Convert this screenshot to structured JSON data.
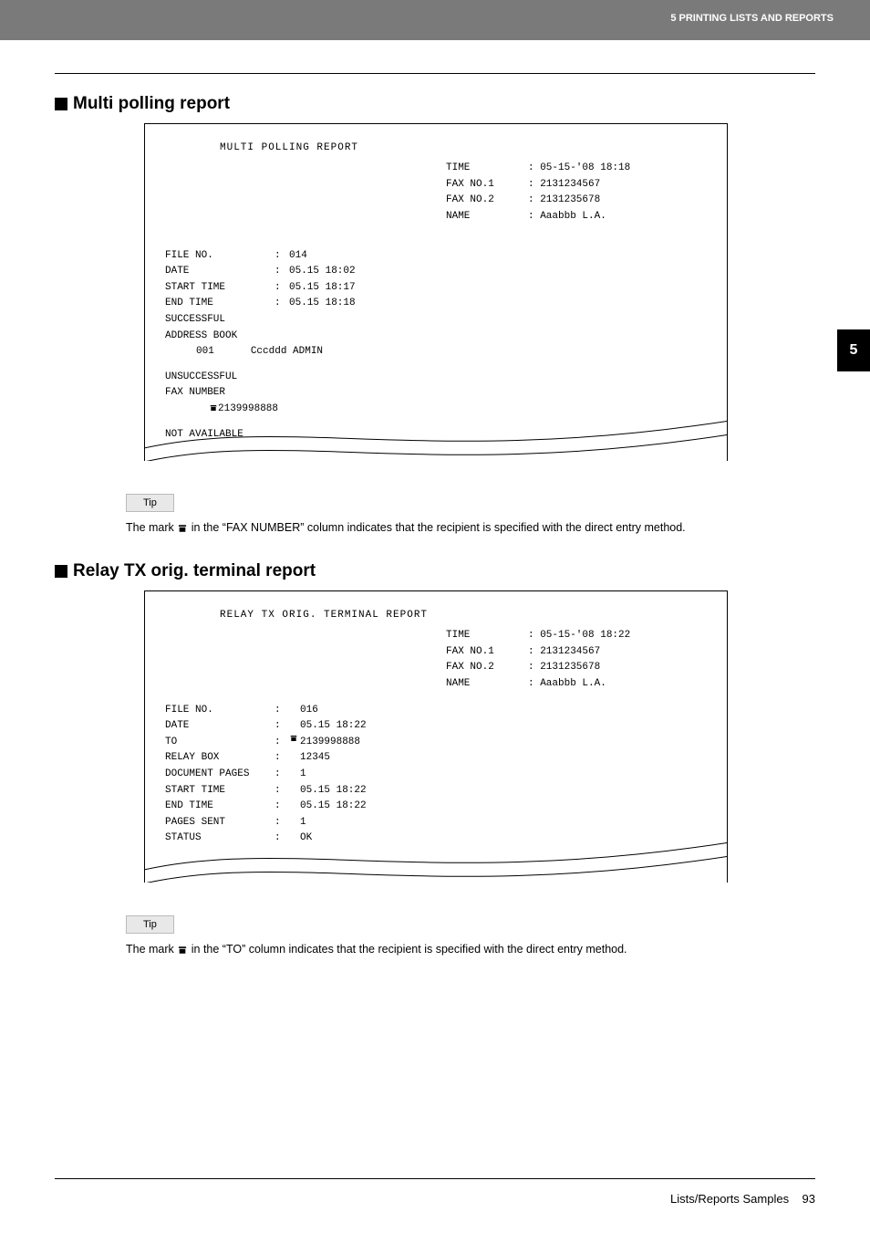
{
  "header": {
    "title": "5 PRINTING LISTS AND REPORTS"
  },
  "chapter_tab": "5",
  "section1": {
    "heading": "Multi polling report",
    "report_title": "MULTI POLLING REPORT",
    "hdr": {
      "time_label": "TIME",
      "time_val": ": 05-15-'08 18:18",
      "fax1_label": "FAX NO.1",
      "fax1_val": ": 2131234567",
      "fax2_label": "FAX NO.2",
      "fax2_val": ": 2131235678",
      "name_label": "NAME",
      "name_val": ": Aaabbb L.A."
    },
    "rows": {
      "file_no_label": "FILE NO.",
      "file_no_val": "014",
      "date_label": "DATE",
      "date_val": "05.15 18:02",
      "start_label": "START TIME",
      "start_val": "05.15 18:17",
      "end_label": "END TIME",
      "end_val": "05.15 18:18",
      "succ_label": "SUCCESSFUL",
      "ab_label": "ADDRESS BOOK",
      "ab_idx": "001",
      "ab_name": "Cccddd ADMIN",
      "unsucc_label": "UNSUCCESSFUL",
      "faxnum_label": "FAX NUMBER",
      "faxnum_val": "2139998888",
      "notavail_label": "NOT AVAILABLE"
    },
    "tip_label": "Tip",
    "tip_text_pre": "The mark ",
    "tip_text_post": " in the “FAX NUMBER” column indicates that the recipient is specified with the direct entry method."
  },
  "section2": {
    "heading": "Relay TX orig. terminal report",
    "report_title": "RELAY TX ORIG. TERMINAL REPORT",
    "hdr": {
      "time_label": "TIME",
      "time_val": ": 05-15-'08 18:22",
      "fax1_label": "FAX NO.1",
      "fax1_val": ": 2131234567",
      "fax2_label": "FAX NO.2",
      "fax2_val": ": 2131235678",
      "name_label": "NAME",
      "name_val": ": Aaabbb L.A."
    },
    "rows": {
      "file_no_label": "FILE NO.",
      "file_no_val": "016",
      "date_label": "DATE",
      "date_val": "05.15 18:22",
      "to_label": "TO",
      "to_val": "2139998888",
      "relay_label": "RELAY BOX",
      "relay_val": "12345",
      "docpages_label": "DOCUMENT PAGES",
      "docpages_val": "1",
      "start_label": "START TIME",
      "start_val": "05.15 18:22",
      "end_label": "END TIME",
      "end_val": "05.15 18:22",
      "pages_sent_label": "PAGES SENT",
      "pages_sent_val": "1",
      "status_label": "STATUS",
      "status_val": "OK"
    },
    "tip_label": "Tip",
    "tip_text_pre": "The mark ",
    "tip_text_post": " in the “TO” column indicates that the recipient is specified with the direct entry method."
  },
  "footer": {
    "text": "Lists/Reports Samples",
    "page": "93"
  }
}
